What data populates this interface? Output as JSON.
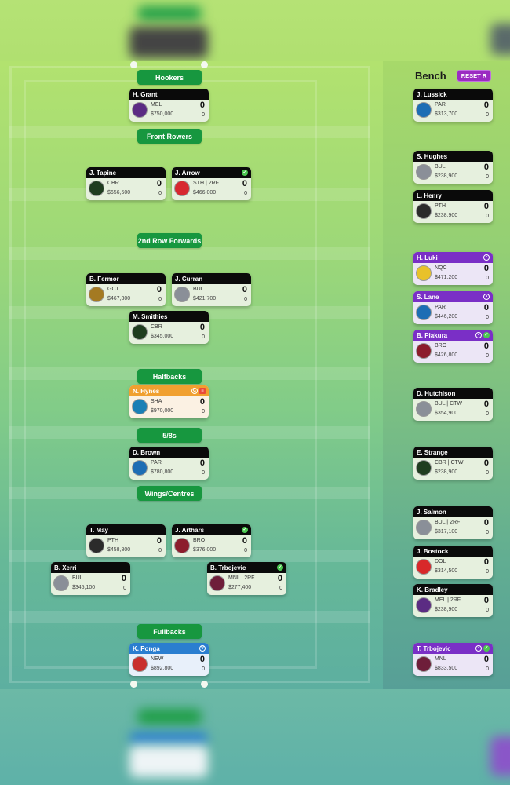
{
  "field": {
    "positions": [
      {
        "label": "Hookers"
      },
      {
        "label": "Front Rowers"
      },
      {
        "label": "2nd Row Forwards"
      },
      {
        "label": "Halfbacks"
      },
      {
        "label": "5/8s"
      },
      {
        "label": "Wings/Centres"
      },
      {
        "label": "Fullbacks"
      }
    ],
    "players": [
      {
        "name": "H. Grant",
        "team": "MEL",
        "price": "$750,000",
        "score": "0",
        "subscore": "0",
        "status": "normal",
        "icons": []
      },
      {
        "name": "J. Tapine",
        "team": "CBR",
        "price": "$656,500",
        "score": "0",
        "subscore": "0",
        "status": "normal",
        "icons": []
      },
      {
        "name": "J. Arrow",
        "team": "STH | 2RF",
        "price": "$466,000",
        "score": "0",
        "subscore": "0",
        "status": "normal",
        "icons": [
          "check"
        ]
      },
      {
        "name": "B. Fermor",
        "team": "GCT",
        "price": "$467,300",
        "score": "0",
        "subscore": "0",
        "status": "normal",
        "icons": []
      },
      {
        "name": "J. Curran",
        "team": "BUL",
        "price": "$421,700",
        "score": "0",
        "subscore": "0",
        "status": "normal",
        "icons": []
      },
      {
        "name": "M. Smithies",
        "team": "CBR",
        "price": "$345,000",
        "score": "0",
        "subscore": "0",
        "status": "normal",
        "icons": []
      },
      {
        "name": "N. Hynes",
        "team": "SHA",
        "price": "$970,000",
        "score": "0",
        "subscore": "0",
        "status": "captain",
        "icons": [
          "captain",
          "flag"
        ]
      },
      {
        "name": "D. Brown",
        "team": "PAR",
        "price": "$780,800",
        "score": "0",
        "subscore": "0",
        "status": "normal",
        "icons": []
      },
      {
        "name": "T. May",
        "team": "PTH",
        "price": "$458,800",
        "score": "0",
        "subscore": "0",
        "status": "normal",
        "icons": []
      },
      {
        "name": "J. Arthars",
        "team": "BRO",
        "price": "$376,000",
        "score": "0",
        "subscore": "0",
        "status": "normal",
        "icons": [
          "check"
        ]
      },
      {
        "name": "B. Xerri",
        "team": "BUL",
        "price": "$345,100",
        "score": "0",
        "subscore": "0",
        "status": "normal",
        "icons": []
      },
      {
        "name": "B. Trbojevic",
        "team": "MNL | 2RF",
        "price": "$277,400",
        "score": "0",
        "subscore": "0",
        "status": "normal",
        "icons": [
          "check"
        ]
      },
      {
        "name": "K. Ponga",
        "team": "NEW",
        "price": "$892,800",
        "score": "0",
        "subscore": "0",
        "status": "vice",
        "icons": [
          "vice"
        ]
      }
    ]
  },
  "bench": {
    "title": "Bench",
    "reset_label": "RESET R",
    "players": [
      {
        "name": "J. Lussick",
        "team": "PAR",
        "price": "$313,700",
        "score": "0",
        "subscore": "0",
        "status": "normal",
        "icons": []
      },
      {
        "name": "S. Hughes",
        "team": "BUL",
        "price": "$238,900",
        "score": "0",
        "subscore": "0",
        "status": "normal",
        "icons": []
      },
      {
        "name": "L. Henry",
        "team": "PTH",
        "price": "$238,900",
        "score": "0",
        "subscore": "0",
        "status": "normal",
        "icons": []
      },
      {
        "name": "H. Luki",
        "team": "NQC",
        "price": "$471,200",
        "score": "0",
        "subscore": "0",
        "status": "emerg",
        "icons": [
          "emerg"
        ]
      },
      {
        "name": "S. Lane",
        "team": "PAR",
        "price": "$446,200",
        "score": "0",
        "subscore": "0",
        "status": "emerg",
        "icons": [
          "emerg"
        ]
      },
      {
        "name": "B. Piakura",
        "team": "BRO",
        "price": "$426,800",
        "score": "0",
        "subscore": "0",
        "status": "emerg",
        "icons": [
          "emerg",
          "check"
        ]
      },
      {
        "name": "D. Hutchison",
        "team": "BUL | CTW",
        "price": "$354,900",
        "score": "0",
        "subscore": "0",
        "status": "normal",
        "icons": []
      },
      {
        "name": "E. Strange",
        "team": "CBR | CTW",
        "price": "$238,900",
        "score": "0",
        "subscore": "0",
        "status": "normal",
        "icons": []
      },
      {
        "name": "J. Salmon",
        "team": "BUL | 2RF",
        "price": "$317,100",
        "score": "0",
        "subscore": "0",
        "status": "normal",
        "icons": []
      },
      {
        "name": "J. Bostock",
        "team": "DOL",
        "price": "$314,500",
        "score": "0",
        "subscore": "0",
        "status": "normal",
        "icons": []
      },
      {
        "name": "K. Bradley",
        "team": "MEL | 2RF",
        "price": "$238,900",
        "score": "0",
        "subscore": "0",
        "status": "normal",
        "icons": []
      },
      {
        "name": "T. Trbojevic",
        "team": "MNL",
        "price": "$833,500",
        "score": "0",
        "subscore": "0",
        "status": "emerg",
        "icons": [
          "emerg",
          "check"
        ]
      }
    ]
  },
  "team_colors": {
    "MEL": "#5b2c83",
    "CBR": "#1f3d1f",
    "STH": "#d7282f",
    "GCT": "#a47a22",
    "BUL": "#8a8f98",
    "SHA": "#1a7fb5",
    "PAR": "#1d6db4",
    "PTH": "#2b2b2b",
    "BRO": "#8c1d2c",
    "MNL": "#6e1e3a",
    "NEW": "#c9302c",
    "NQC": "#e8c12a",
    "DOL": "#d8282a"
  }
}
